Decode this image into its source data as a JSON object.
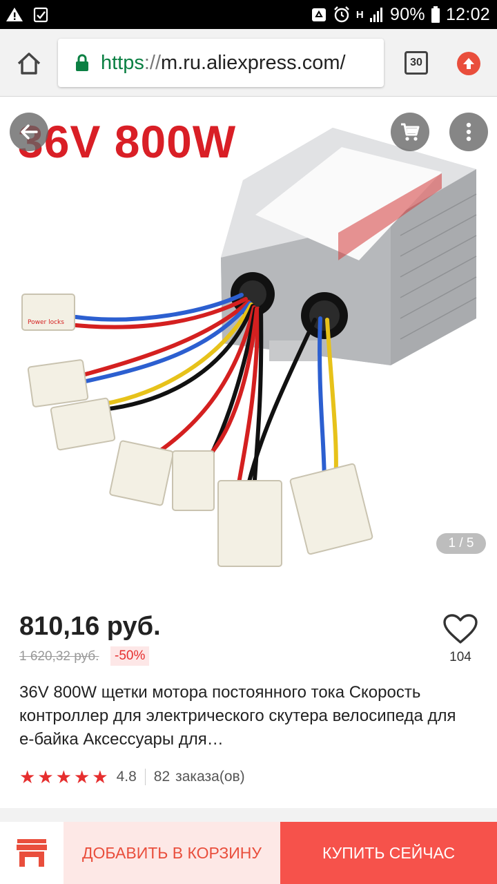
{
  "status_bar": {
    "battery": "90%",
    "time": "12:02",
    "network": "H",
    "icons": [
      "warning-icon",
      "checkbox-icon",
      "recycle-icon",
      "alarm-icon",
      "signal-icon",
      "battery-icon"
    ]
  },
  "browser": {
    "url_scheme": "https",
    "url_sep": "://",
    "url_host": "m.ru.aliexpress.com/",
    "tab_count": "30"
  },
  "gallery": {
    "image_title": "36V 800W",
    "counter": "1 / 5"
  },
  "product": {
    "price": "810,16 руб.",
    "old_price": "1 620,32 руб.",
    "discount": "-50%",
    "wish_count": "104",
    "title": "36V 800W щетки мотора постоянного тока Скорость контроллер для электрического скутера велосипеда для е-байка Аксессуары для…",
    "rating": "4.8",
    "orders_count": "82",
    "orders_label": "заказа(ов)",
    "stars": 5
  },
  "actions": {
    "add_to_cart": "ДОБАВИТЬ В КОРЗИНУ",
    "buy_now": "КУПИТЬ СЕЙЧАС"
  },
  "colors": {
    "accent": "#e94e3c",
    "buy": "#f6524b",
    "price_red": "#e62e2e",
    "url_green": "#0b8043"
  }
}
